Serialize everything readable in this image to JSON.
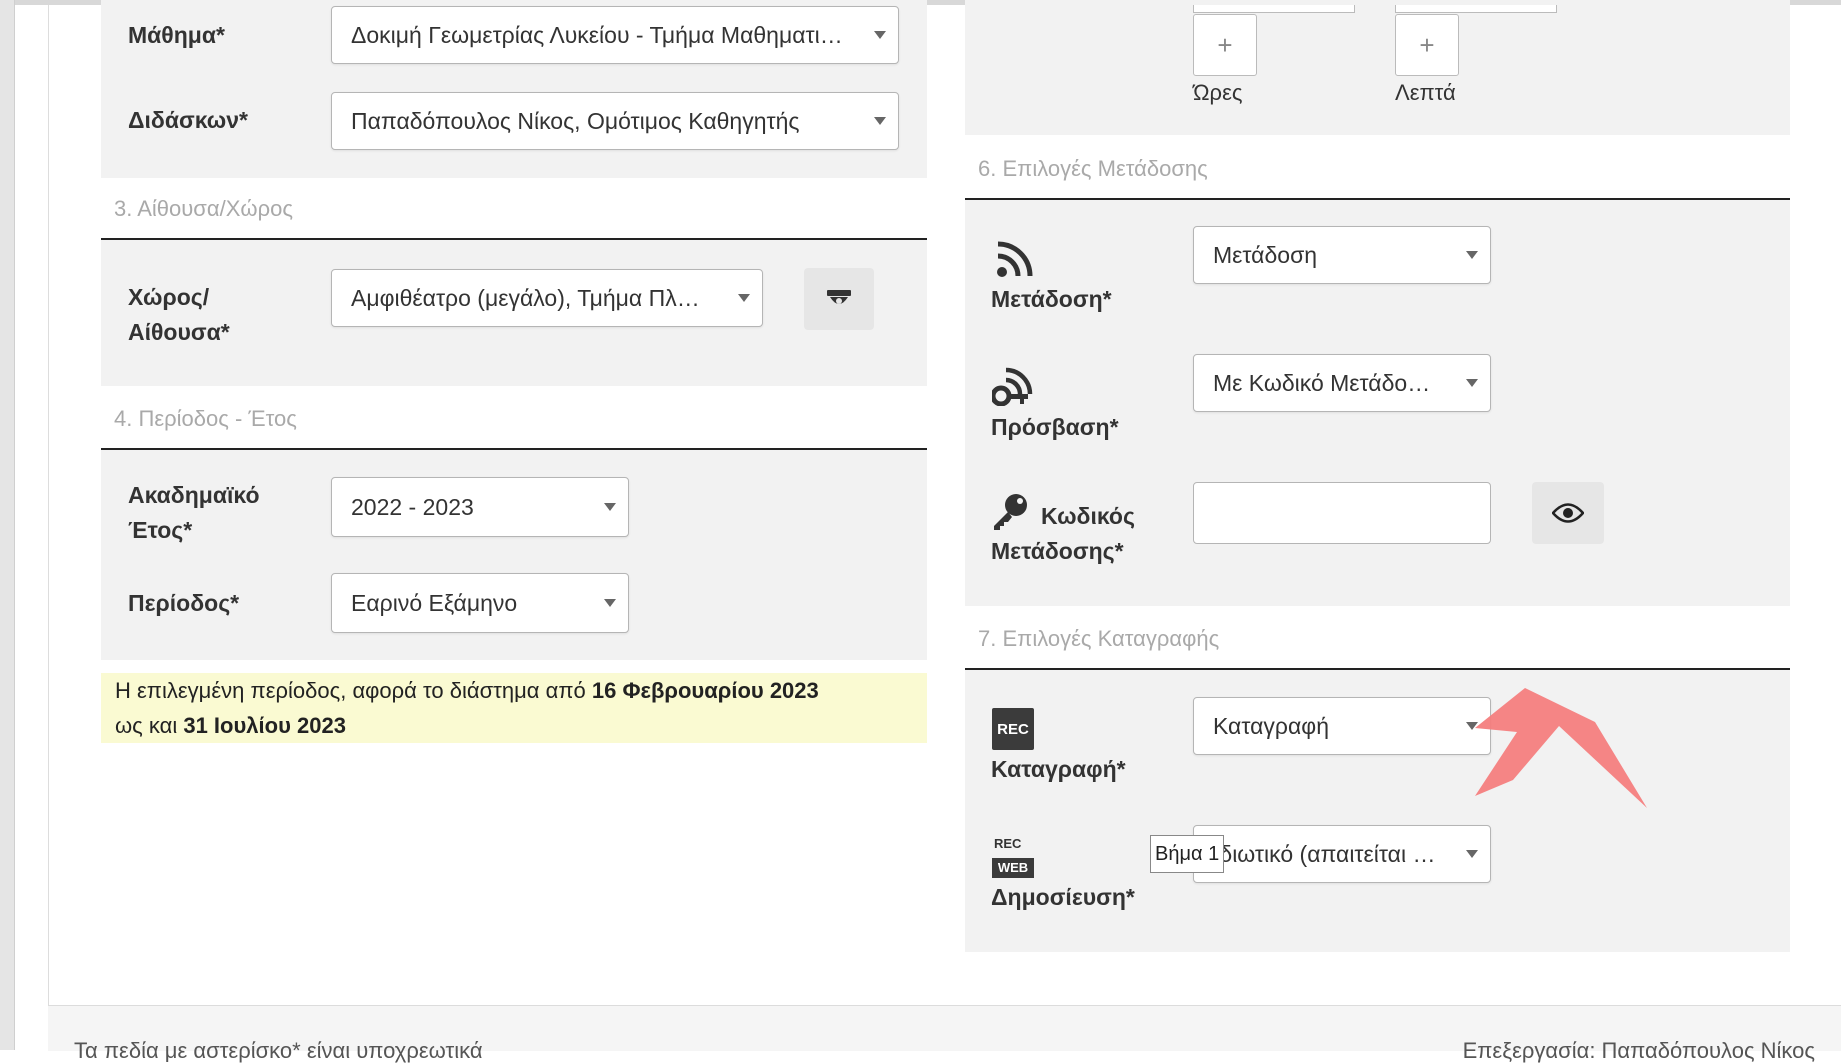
{
  "form": {
    "course": {
      "label": "Μάθημα*",
      "value": "Δοκιμή Γεωμετρίας Λυκείου - Τμήμα Μαθηματικών"
    },
    "instructor": {
      "label": "Διδάσκων*",
      "value": "Παπαδόπουλος Νίκος, Ομότιμος Καθηγητής"
    },
    "room_section": {
      "title": "3. Αίθουσα/Χώρος",
      "label_line1": "Χώρος/",
      "label_line2": "Αίθουσα*",
      "value": "Αμφιθέατρο (μεγάλο), Τμήμα Πληροφορικής"
    },
    "period_section": {
      "title": "4. Περίοδος - Έτος",
      "year_label_line1": "Ακαδημαϊκό",
      "year_label_line2": "Έτος*",
      "year_value": "2022 - 2023",
      "period_label": "Περίοδος*",
      "period_value": "Εαρινό Εξάμηνο",
      "info_prefix": "Η επιλεγμένη περίοδος, αφορά το διάστημα από ",
      "info_start": "16 Φεβρουαρίου 2023",
      "info_middle": "ως και ",
      "info_end": "31 Ιουλίου 2023"
    },
    "duration": {
      "hours_label": "Ώρες",
      "minutes_label": "Λεπτά",
      "increment": "+"
    },
    "broadcast_section": {
      "title": "6. Επιλογές Μετάδοσης",
      "broadcast_label": "Μετάδοση*",
      "broadcast_value": "Μετάδοση",
      "access_label": "Πρόσβαση*",
      "access_value": "Με Κωδικό Μετάδοσης",
      "code_label_line1": "Κωδικός",
      "code_label_line2": "Μετάδοσης*",
      "code_value": ""
    },
    "recording_section": {
      "title": "7. Επιλογές Καταγραφής",
      "recording_label": "Καταγραφή*",
      "recording_value": "Καταγραφή",
      "publish_label": "Δημοσίευση*",
      "publish_value": "Ιδιωτικό (απαιτείται σύνδεση)",
      "rec_icon_text": "REC",
      "rec_web_top": "REC",
      "rec_web_bottom": "WEB"
    }
  },
  "tooltip": {
    "text": "Βήμα 1"
  },
  "footer": {
    "required_note": "Τα πεδία με αστερίσκο* είναι υποχρεωτικά",
    "editor_note": "Επεξεργασία: Παπαδόπουλος Νίκος"
  },
  "icons": [
    "rss-icon",
    "key-rss-icon",
    "key-icon",
    "eye-icon",
    "camera-icon",
    "rec-icon",
    "rec-web-icon",
    "annotation-arrow"
  ],
  "colors": {
    "panel_bg": "#f2f2f2",
    "info_bg": "#fafad2",
    "arrow": "#f47e7e",
    "section_title": "#a9a9a9"
  }
}
